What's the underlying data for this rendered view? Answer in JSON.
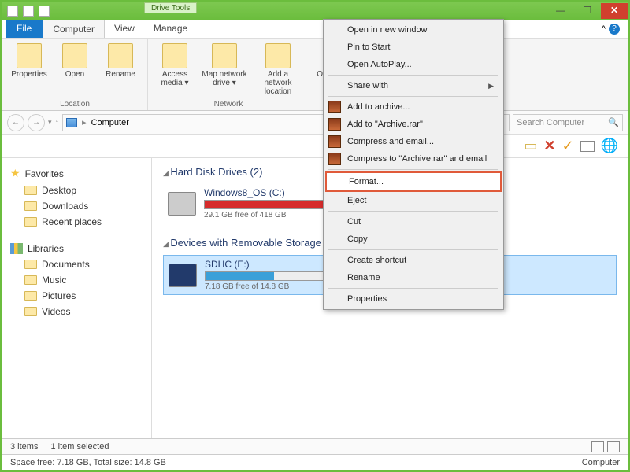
{
  "titlebar": {
    "tool_tab": "Drive Tools"
  },
  "window_buttons": {
    "min": "—",
    "max": "❐",
    "close": "✕"
  },
  "menubar": {
    "file": "File",
    "tabs": [
      "Computer",
      "View",
      "Manage"
    ],
    "help_arrow": "^"
  },
  "ribbon": {
    "groups": [
      {
        "label": "Location",
        "buttons": [
          "Properties",
          "Open",
          "Rename"
        ]
      },
      {
        "label": "Network",
        "buttons": [
          "Access media ▾",
          "Map network drive ▾",
          "Add a network location"
        ]
      },
      {
        "label": "",
        "buttons": [
          "Open Control Panel"
        ]
      }
    ]
  },
  "addressbar": {
    "path": "Computer",
    "search_placeholder": "Search Computer"
  },
  "sidebar": {
    "favorites": {
      "label": "Favorites",
      "items": [
        "Desktop",
        "Downloads",
        "Recent places"
      ]
    },
    "libraries": {
      "label": "Libraries",
      "items": [
        "Documents",
        "Music",
        "Pictures",
        "Videos"
      ]
    }
  },
  "main": {
    "hdd_section": "Hard Disk Drives (2)",
    "hdd": {
      "name": "Windows8_OS (C:)",
      "free": "29.1 GB free of 418 GB"
    },
    "removable_section": "Devices with Removable Storage",
    "sd": {
      "name": "SDHC (E:)",
      "free": "7.18 GB free of 14.8 GB"
    }
  },
  "context_menu": {
    "open_new": "Open in new window",
    "pin": "Pin to Start",
    "autoplay": "Open AutoPlay...",
    "share": "Share with",
    "add_archive": "Add to archive...",
    "add_rar": "Add to \"Archive.rar\"",
    "compress_email": "Compress and email...",
    "compress_rar_email": "Compress to \"Archive.rar\" and email",
    "format": "Format...",
    "eject": "Eject",
    "cut": "Cut",
    "copy": "Copy",
    "shortcut": "Create shortcut",
    "rename": "Rename",
    "properties": "Properties"
  },
  "statusbar": {
    "items": "3 items",
    "selected": "1 item selected"
  },
  "statusbar2": {
    "space": "Space free: 7.18 GB, Total size: 14.8 GB",
    "computer": "Computer"
  }
}
